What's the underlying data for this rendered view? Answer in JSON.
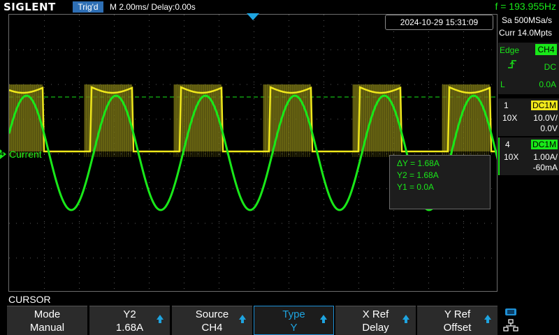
{
  "header": {
    "logo": "SIGLENT",
    "trigger_status": "Trig'd",
    "timebase": "M 2.00ms/ Delay:0.00s",
    "frequency": "f = 193.955Hz"
  },
  "screen": {
    "datetime": "2024-10-29 15:31:09",
    "ch4_label": "Current",
    "ch4_number": "4",
    "cursor_readout": {
      "delta_y": "ΔY = 1.68A",
      "y2": "Y2 = 1.68A",
      "y1": "Y1 = 0.0A"
    }
  },
  "right_panel": {
    "sample_rate": "Sa 500MSa/s",
    "memory_depth": "Curr 14.0Mpts",
    "trigger": {
      "type": "Edge",
      "source": "CH4",
      "coupling": "DC",
      "level_label": "L",
      "level": "0.0A",
      "slope_icon": "rising-edge-icon"
    },
    "channels": [
      {
        "number": "1",
        "coupling": "DC1M",
        "probe": "10X",
        "scale": "10.0V/",
        "offset": "0.0V",
        "color": "#f0e81b"
      },
      {
        "number": "4",
        "coupling": "DC1M",
        "probe": "10X",
        "scale": "1.00A/",
        "offset": "-60mA",
        "color": "#19e819"
      }
    ]
  },
  "menu": {
    "title": "CURSOR",
    "softkeys": [
      {
        "top": "Mode",
        "bottom": "Manual",
        "arrow": false,
        "active": false
      },
      {
        "top": "Y2",
        "bottom": "1.68A",
        "arrow": true,
        "active": false
      },
      {
        "top": "Source",
        "bottom": "CH4",
        "arrow": true,
        "active": false
      },
      {
        "top": "Type",
        "bottom": "Y",
        "arrow": true,
        "active": true
      },
      {
        "top": "X Ref",
        "bottom": "Delay",
        "arrow": true,
        "active": false
      },
      {
        "top": "Y Ref",
        "bottom": "Offset",
        "arrow": true,
        "active": false
      }
    ]
  },
  "colors": {
    "ch1": "#f0e81b",
    "ch4": "#19e819",
    "accent": "#1ea4e0"
  }
}
